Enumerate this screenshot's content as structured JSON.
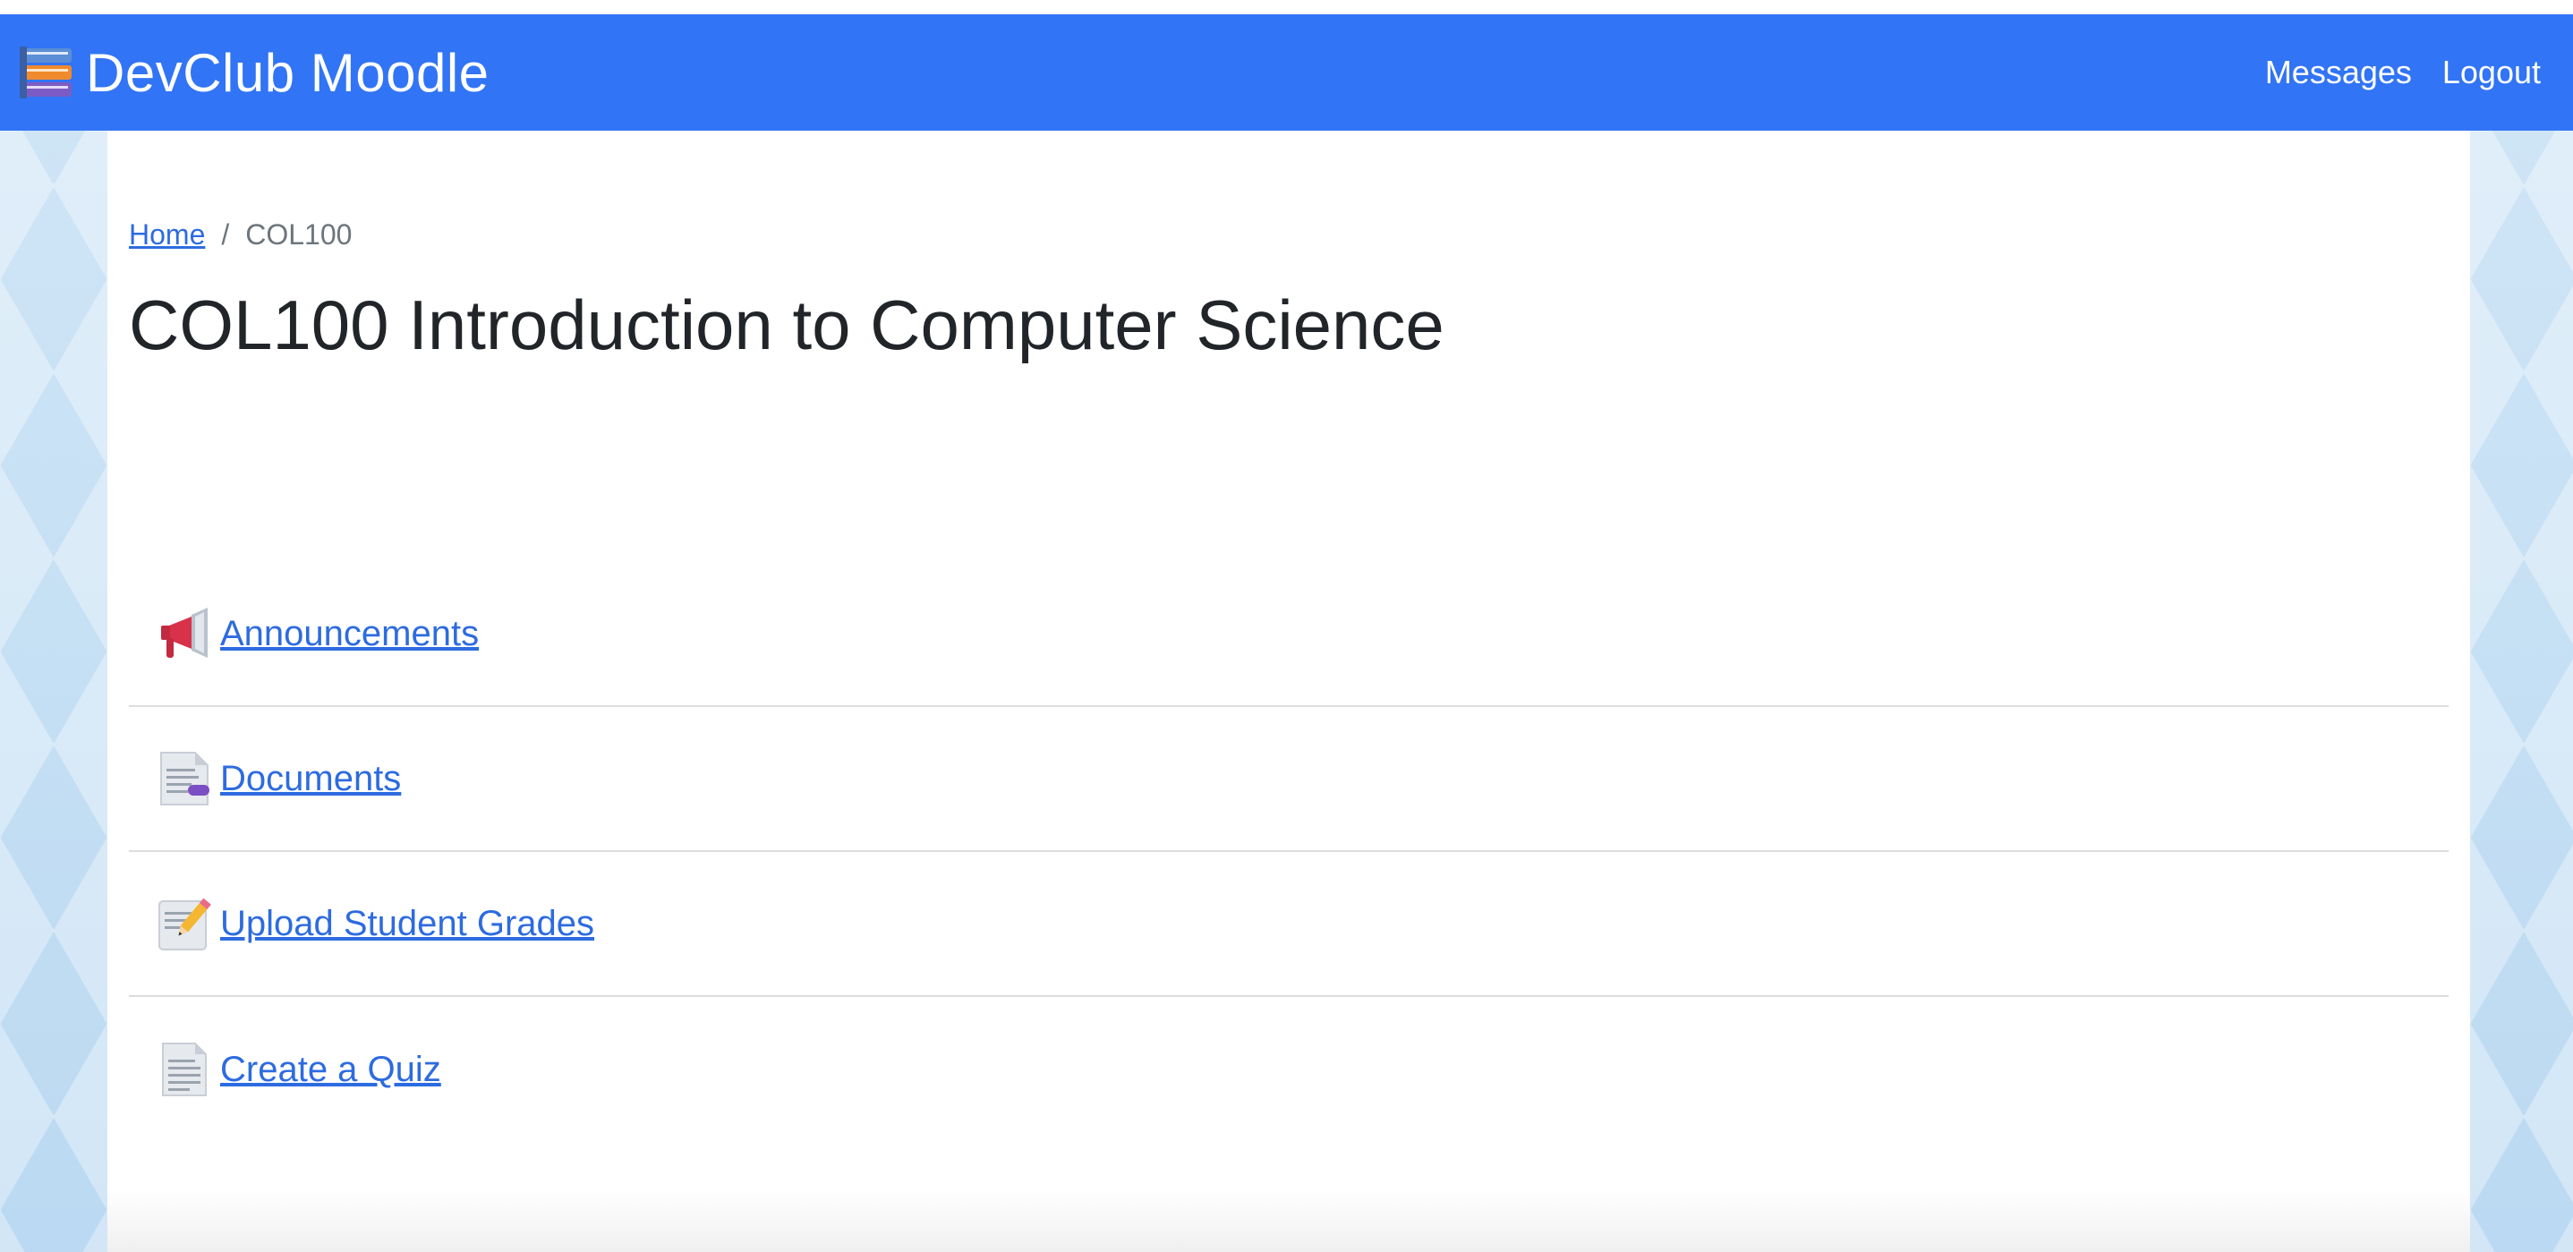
{
  "header": {
    "brand": "DevClub Moodle",
    "brand_icon": "books-icon",
    "links": [
      "Messages",
      "Logout"
    ]
  },
  "breadcrumb": {
    "home": "Home",
    "separator": "/",
    "current": "COL100"
  },
  "page": {
    "title": "COL100 Introduction to Computer Science"
  },
  "activities": [
    {
      "label": "Announcements",
      "icon": "megaphone-icon"
    },
    {
      "label": "Documents",
      "icon": "document-icon"
    },
    {
      "label": "Upload Student Grades",
      "icon": "memo-pencil-icon"
    },
    {
      "label": "Create a Quiz",
      "icon": "page-icon"
    }
  ],
  "colors": {
    "navbar": "#3174f5",
    "link": "#2d6be0",
    "title_text": "#212529"
  }
}
